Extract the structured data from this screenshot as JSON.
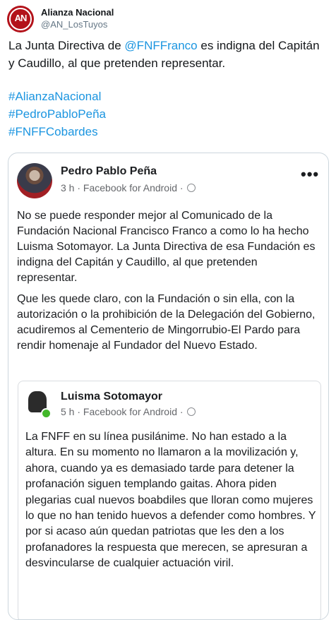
{
  "tweet": {
    "avatar_text": "AN",
    "author_name": "Alianza Nacional",
    "author_handle": "@AN_LosTuyos",
    "text_before": "La Junta Directiva de ",
    "mention": "@FNFFranco",
    "text_after": " es indigna del Capitán y Caudillo, al que pretenden representar.",
    "hashtags": [
      "#AlianzaNacional",
      "#PedroPabloPeña",
      "#FNFFCobardes"
    ]
  },
  "facebook_post": {
    "author_name": "Pedro Pablo Peña",
    "meta": "3 h · Facebook for Android ·",
    "more_label": "•••",
    "paragraphs": [
      "No se puede responder mejor al Comunicado de la Fundación Nacional Francisco Franco a como lo ha hecho Luisma Sotomayor. La Junta Directiva de esa Fundación es indigna del Capitán y Caudillo, al que pretenden representar.",
      "Que les quede claro, con la Fundación o sin ella, con la autorización o la prohibición de la Delegación del Gobierno, acudiremos al Cementerio de Mingorrubio-El Pardo para rendir homenaje al Fundador del Nuevo Estado."
    ],
    "shared_post": {
      "author_name": "Luisma Sotomayor",
      "meta": "5 h · Facebook for Android ·",
      "text": "La FNFF en su línea pusilánime. No han estado a la altura. En su momento no llamaron a la movilización y, ahora, cuando ya es demasiado tarde para detener la profanación siguen templando gaitas. Ahora piden plegarias cual nuevos boabdiles que lloran como mujeres lo que no han tenido huevos a defender como hombres. Y por si acaso aún quedan patriotas que les den a los profanadores la respuesta que merecen, se apresuran a desvincularse de cualquier actuación viril."
    }
  },
  "colors": {
    "link": "#1b95e0",
    "brand_red": "#b3121a",
    "online_green": "#42b72a"
  }
}
